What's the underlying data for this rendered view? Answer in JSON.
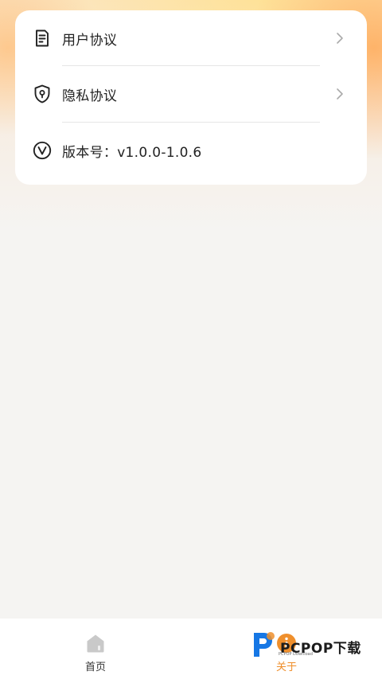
{
  "settings": {
    "items": [
      {
        "label": "用户协议",
        "icon": "document-icon",
        "has_arrow": true
      },
      {
        "label": "隐私协议",
        "icon": "shield-icon",
        "has_arrow": true
      },
      {
        "label": "版本号：v1.0.0-1.0.6",
        "icon": "version-icon",
        "has_arrow": false
      }
    ]
  },
  "tabbar": {
    "tabs": [
      {
        "label": "首页",
        "icon": "home-icon",
        "active": false
      },
      {
        "label": "关于",
        "icon": "info-icon",
        "active": true
      }
    ]
  },
  "watermark": {
    "text": "PCPOP下载",
    "sub": "PCPOP Download"
  },
  "colors": {
    "accent": "#ef8f2c",
    "background": "#f5f4f2",
    "card": "#ffffff"
  }
}
